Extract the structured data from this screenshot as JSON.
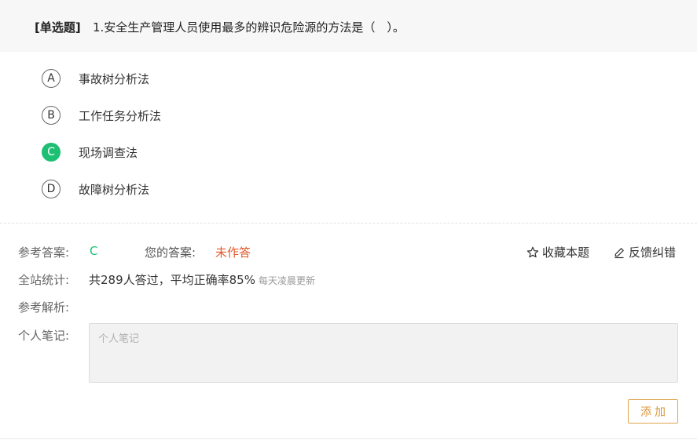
{
  "question": {
    "type_label": "[单选题]",
    "text": "1.安全生产管理人员使用最多的辨识危险源的方法是（　）。",
    "options": [
      {
        "letter": "A",
        "text": "事故树分析法",
        "correct": false
      },
      {
        "letter": "B",
        "text": "工作任务分析法",
        "correct": false
      },
      {
        "letter": "C",
        "text": "现场调查法",
        "correct": true
      },
      {
        "letter": "D",
        "text": "故障树分析法",
        "correct": false
      }
    ]
  },
  "answer": {
    "ref_label": "参考答案:",
    "ref_value": "C",
    "your_label": "您的答案:",
    "your_value": "未作答",
    "favorite_label": "收藏本题",
    "feedback_label": "反馈纠错"
  },
  "stats": {
    "label": "全站统计:",
    "text": "共289人答过，平均正确率85%",
    "note": "每天凌晨更新"
  },
  "analysis": {
    "label": "参考解析:"
  },
  "notes": {
    "label": "个人笔记:",
    "placeholder": "个人笔记",
    "add_label": "添加"
  },
  "colors": {
    "correct": "#1dbf73",
    "unanswered": "#e0592a",
    "add_button": "#d8963a"
  },
  "icons": {
    "favorite": "star-icon",
    "feedback": "pencil-icon"
  }
}
